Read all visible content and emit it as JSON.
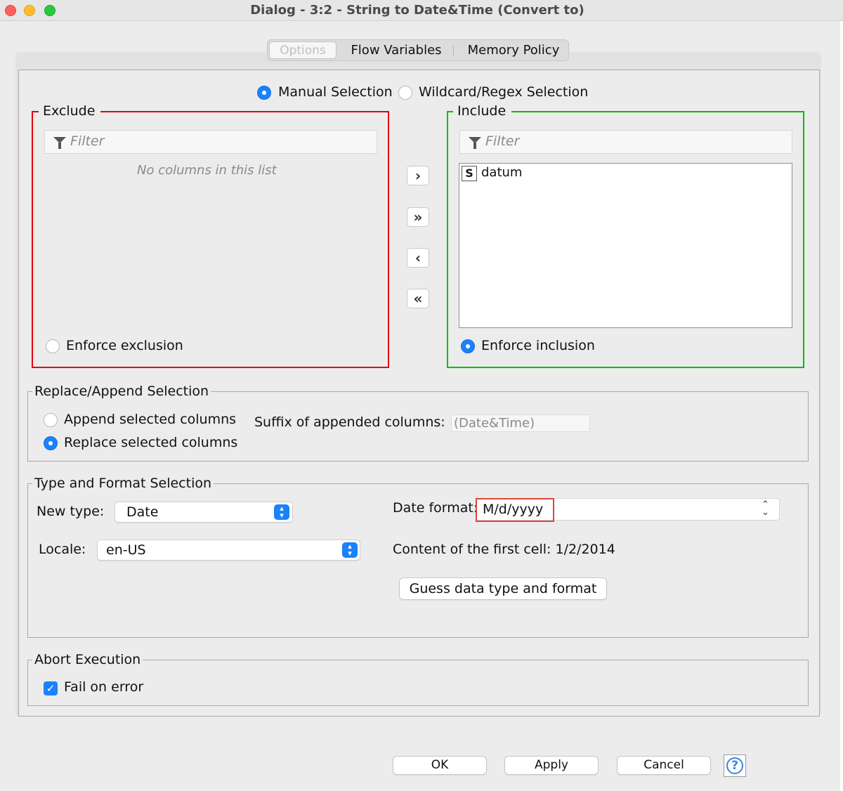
{
  "window": {
    "title": "Dialog - 3:2 - String to Date&Time (Convert to)"
  },
  "tabs": [
    "Options",
    "Flow Variables",
    "Memory Policy"
  ],
  "selection_mode": {
    "manual": "Manual Selection",
    "wildcard": "Wildcard/Regex Selection",
    "selected": "manual"
  },
  "exclude": {
    "title": "Exclude",
    "filter_placeholder": "Filter",
    "empty_text": "No columns in this list",
    "enforce_label": "Enforce exclusion",
    "enforce_selected": false,
    "border_color": "#e8000b"
  },
  "include": {
    "title": "Include",
    "filter_placeholder": "Filter",
    "items": [
      {
        "type_badge": "S",
        "name": "datum"
      }
    ],
    "enforce_label": "Enforce inclusion",
    "enforce_selected": true,
    "border_color": "#00c000"
  },
  "move_buttons": [
    {
      "name": "add",
      "glyph": "›"
    },
    {
      "name": "add-all",
      "glyph": "»"
    },
    {
      "name": "remove",
      "glyph": "‹"
    },
    {
      "name": "remove-all",
      "glyph": "«"
    }
  ],
  "replace_append": {
    "title": "Replace/Append Selection",
    "append_label": "Append selected columns",
    "replace_label": "Replace selected columns",
    "selected": "replace",
    "suffix_label": "Suffix of appended columns:",
    "suffix_value": "(Date&Time)"
  },
  "type_format": {
    "title": "Type and Format Selection",
    "new_type_label": "New type:",
    "new_type_value": "Date",
    "locale_label": "Locale:",
    "locale_value": "en-US",
    "date_format_label": "Date format:",
    "date_format_value": "M/d/yyyy",
    "first_cell_text": "Content of the first cell: 1/2/2014",
    "guess_button": "Guess data type and format"
  },
  "abort": {
    "title": "Abort Execution",
    "fail_label": "Fail on error",
    "fail_checked": true
  },
  "footer": {
    "ok": "OK",
    "apply": "Apply",
    "cancel": "Cancel",
    "help": "?"
  },
  "colors": {
    "accent": "#1a82fb",
    "highlight": "#e0453a"
  }
}
